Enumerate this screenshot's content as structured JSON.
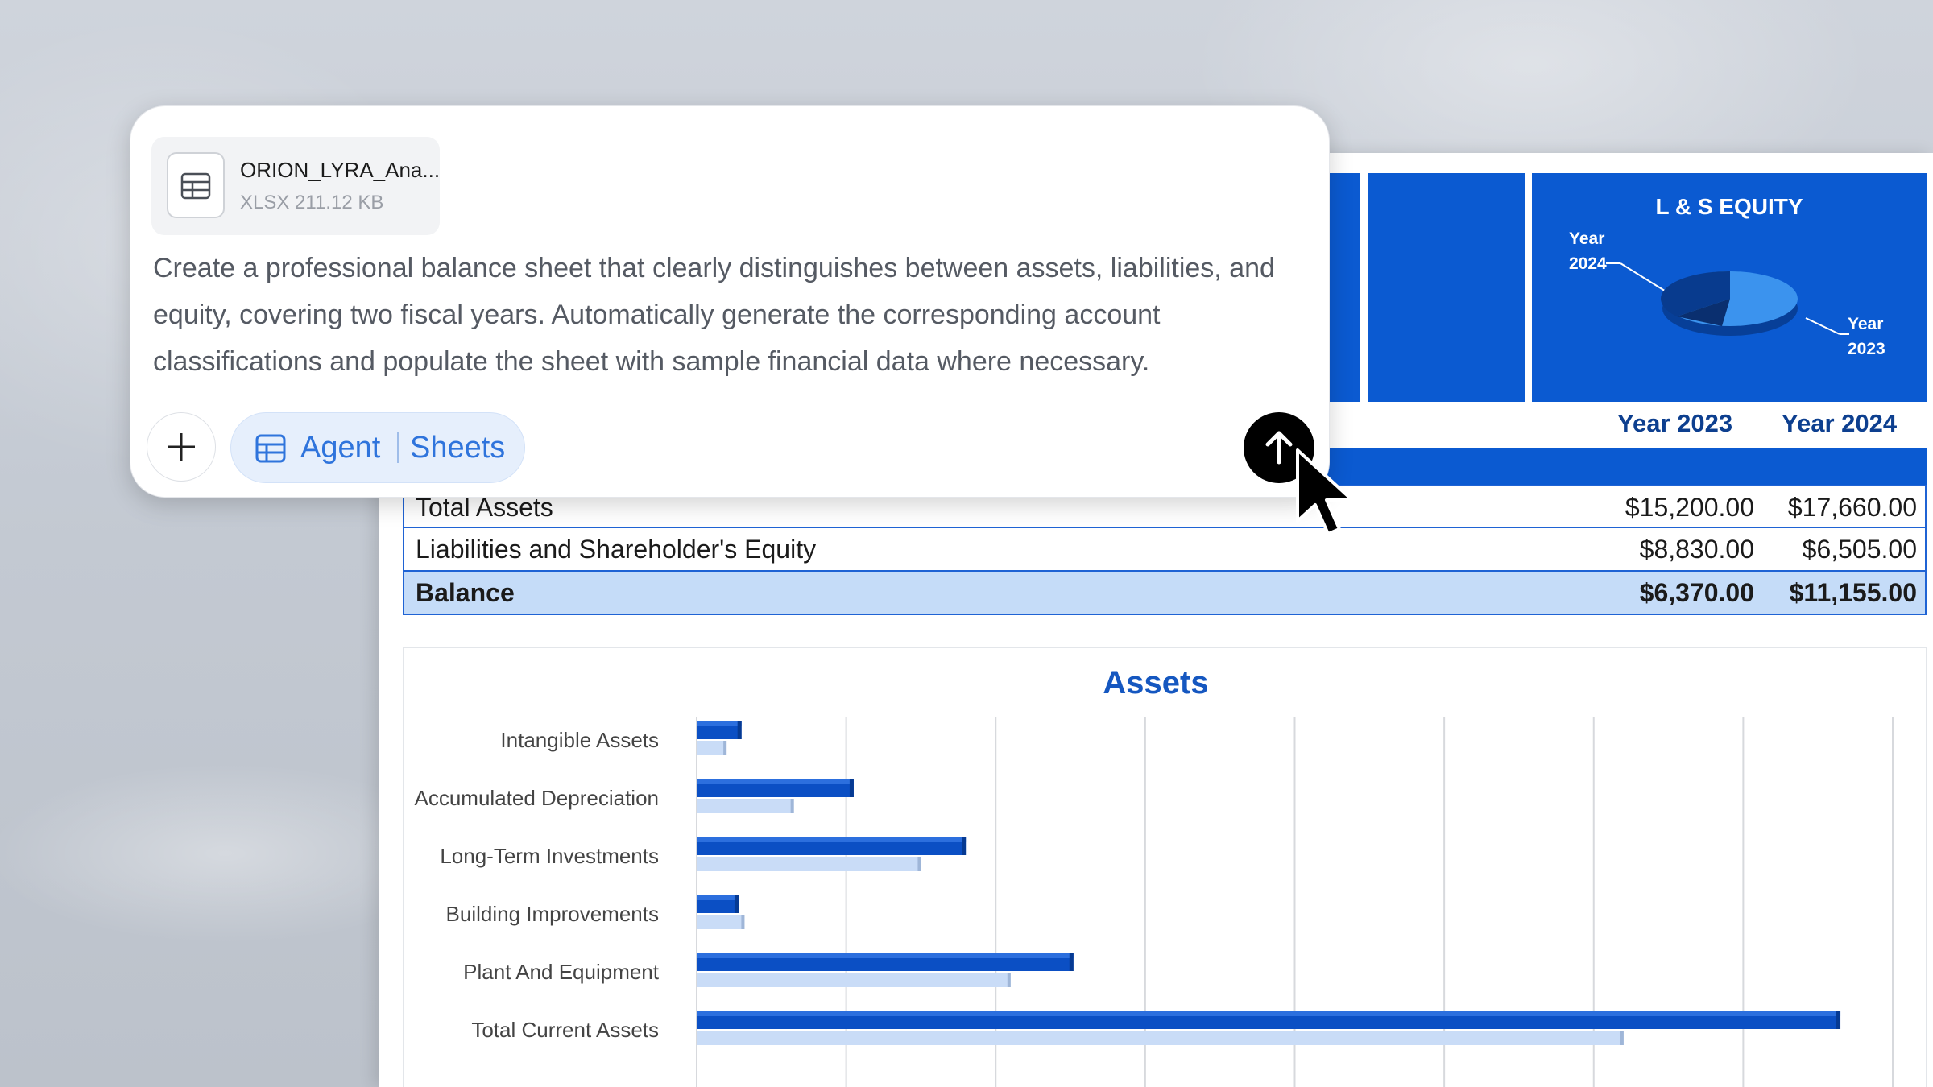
{
  "attachment": {
    "name": "ORION_LYRA_Ana...",
    "meta": "XLSX 211.12 KB",
    "icon": "spreadsheet-file-icon"
  },
  "prompt": {
    "text": "Create a professional balance sheet that clearly distinguishes between assets, liabilities, and equity, covering two fiscal years. Automatically generate the corresponding account classifications and populate the sheet with sample financial data where necessary."
  },
  "composer": {
    "add_icon": "plus-icon",
    "mode_agent": "Agent",
    "mode_sheets": "Sheets",
    "send_icon": "arrow-up-icon"
  },
  "sheet": {
    "equity_card": {
      "title": "L & S EQUITY",
      "label_2024_line1": "Year",
      "label_2024_line2": "2024",
      "label_2023_line1": "Year",
      "label_2023_line2": "2023",
      "pie_values": {
        "year_2024": 23,
        "year_2023": 77
      }
    },
    "columns": [
      "Year 2023",
      "Year 2024"
    ],
    "rows": [
      {
        "label": "Total Assets",
        "y2023": "$15,200.00",
        "y2024": "$17,660.00"
      },
      {
        "label": "Liabilities and Shareholder's Equity",
        "y2023": "$8,830.00",
        "y2024": "$6,505.00"
      },
      {
        "label": "Balance",
        "y2023": "$6,370.00",
        "y2024": "$11,155.00"
      }
    ]
  },
  "colors": {
    "brand_blue": "#0b5ad1",
    "bar_dark": "#0b4fc4",
    "bar_light": "#c9dcf7",
    "balance_row": "#c5dcf8"
  },
  "chart_data": {
    "type": "bar",
    "orientation": "horizontal",
    "title": "Assets",
    "categories": [
      "Intangible Assets",
      "Accumulated Depreciation",
      "Long-Term Investments",
      "Building Improvements",
      "Plant And Equipment",
      "Total Current Assets"
    ],
    "series": [
      {
        "values": [
          300,
          1050,
          1800,
          280,
          2520,
          7650
        ]
      },
      {
        "values": [
          200,
          650,
          1500,
          320,
          2100,
          6200
        ]
      }
    ],
    "xlim": [
      0,
      8000
    ],
    "grid": true
  }
}
